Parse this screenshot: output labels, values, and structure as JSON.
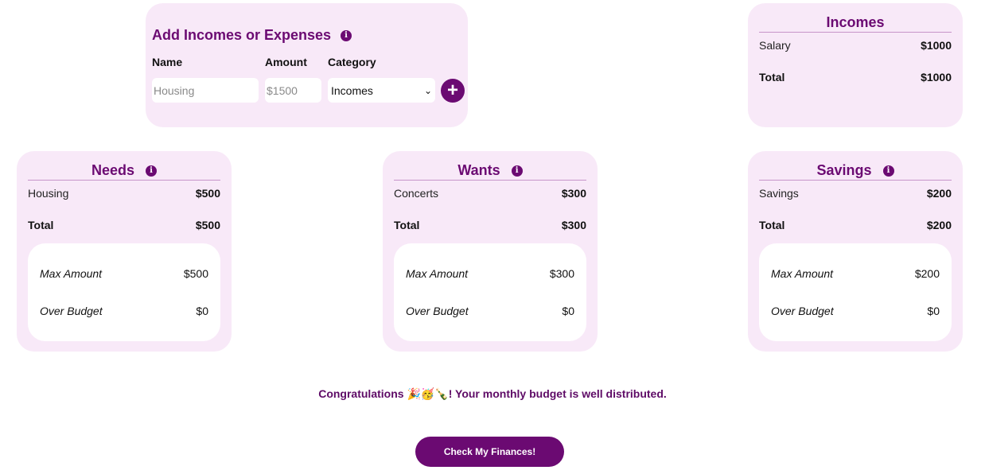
{
  "add_form": {
    "title": "Add Incomes or Expenses",
    "info_icon": "info-icon",
    "name_label": "Name",
    "amount_label": "Amount",
    "category_label": "Category",
    "name_placeholder": "Housing",
    "amount_placeholder": "$1500",
    "category_selected": "Incomes",
    "add_button": "+"
  },
  "incomes": {
    "title": "Incomes",
    "items": [
      {
        "name": "Salary",
        "amount": "$1000"
      }
    ],
    "total_label": "Total",
    "total": "$1000"
  },
  "needs": {
    "title": "Needs",
    "items": [
      {
        "name": "Housing",
        "amount": "$500"
      }
    ],
    "total_label": "Total",
    "total": "$500",
    "max_label": "Max Amount",
    "max_amount": "$500",
    "over_label": "Over Budget",
    "over_amount": "$0"
  },
  "wants": {
    "title": "Wants",
    "items": [
      {
        "name": "Concerts",
        "amount": "$300"
      }
    ],
    "total_label": "Total",
    "total": "$300",
    "max_label": "Max Amount",
    "max_amount": "$300",
    "over_label": "Over Budget",
    "over_amount": "$0"
  },
  "savings": {
    "title": "Savings",
    "items": [
      {
        "name": "Savings",
        "amount": "$200"
      }
    ],
    "total_label": "Total",
    "total": "$200",
    "max_label": "Max Amount",
    "max_amount": "$200",
    "over_label": "Over Budget",
    "over_amount": "$0"
  },
  "message": "Congratulations 🎉🥳🍾! Your monthly budget is well distributed.",
  "check_button": "Check My Finances!",
  "colors": {
    "accent": "#6b0a72",
    "card_bg": "#f8e9f8"
  }
}
